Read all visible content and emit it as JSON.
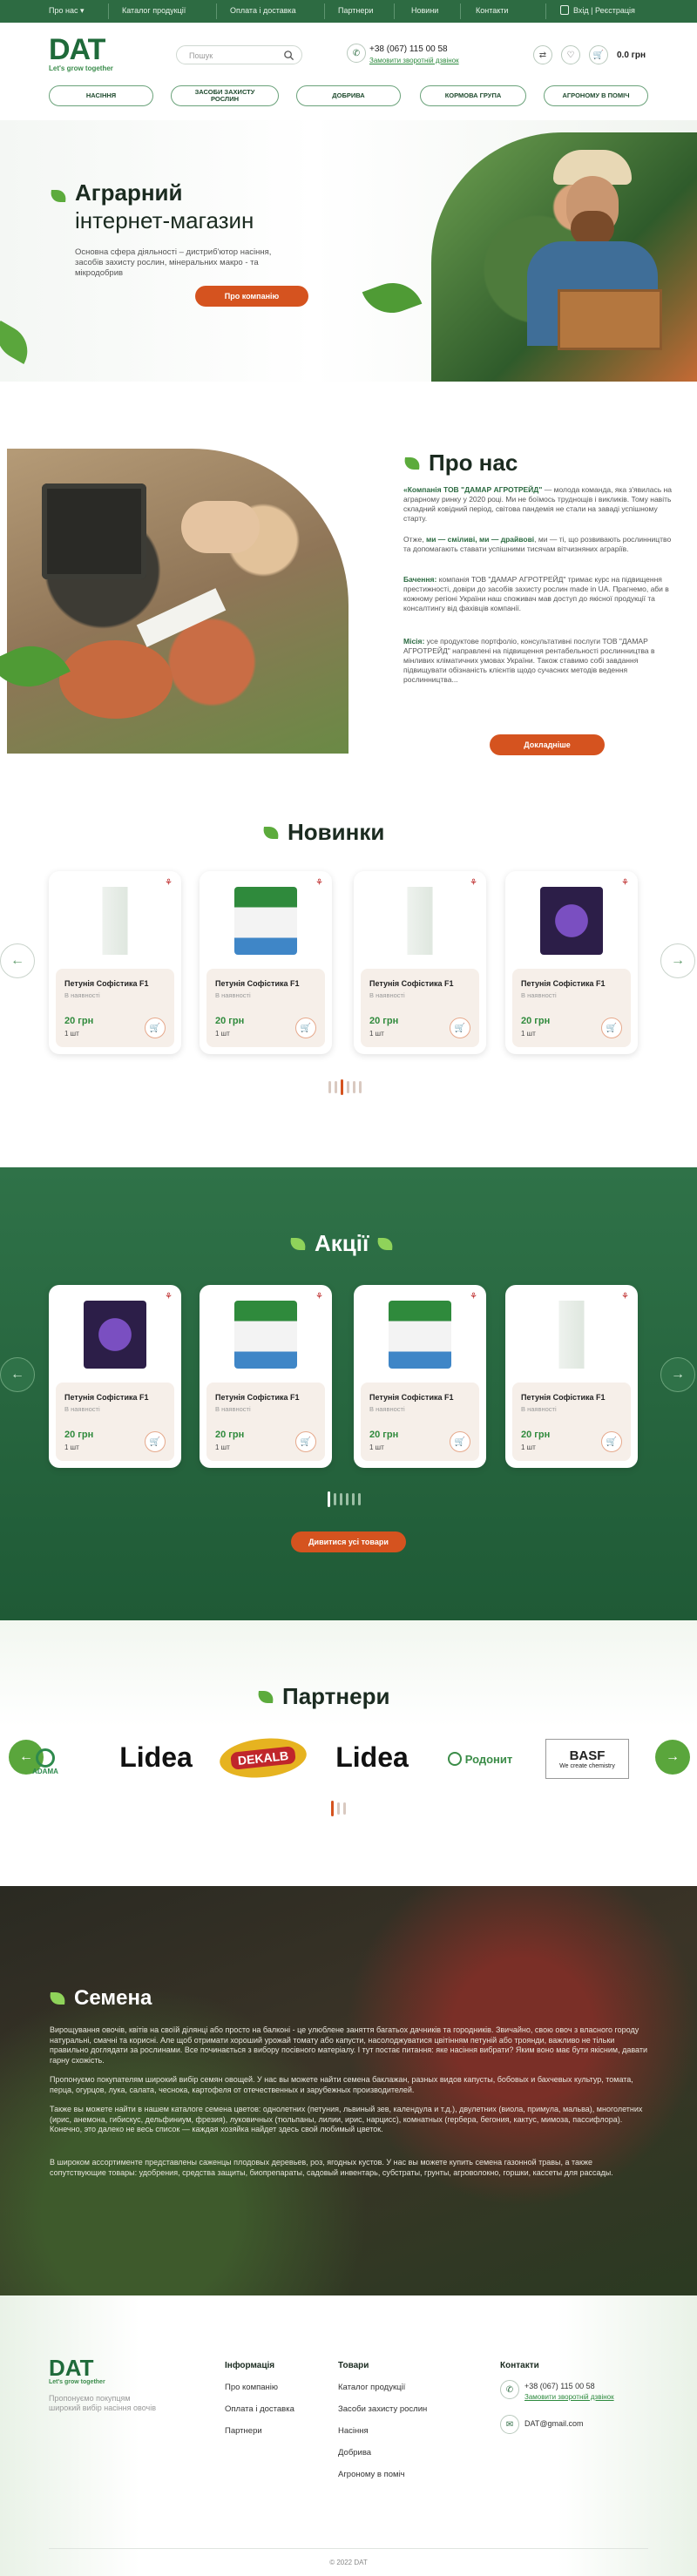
{
  "topbar": {
    "nav": [
      "Про нас",
      "Каталог продукції",
      "Оплата і доставка",
      "Партнери",
      "Новини",
      "Контакти"
    ],
    "login": "Вхід | Реєстрація"
  },
  "header": {
    "logo": "DAT",
    "slogan": "Let's grow together",
    "search_placeholder": "Пошук",
    "phone": "+38 (067) 115 00 58",
    "callback": "Замовити зворотній дзвінок",
    "cart_total": "0.0 грн",
    "categories": [
      "НАСІННЯ",
      "ЗАСОБИ ЗАХИСТУ РОСЛИН",
      "ДОБРИВА",
      "КОРМОВА ГРУПА",
      "АГРОНОМУ В ПОМІЧ"
    ]
  },
  "hero": {
    "title": "Аграрний",
    "subtitle": "інтернет-магазин",
    "text": "Основна сфера діяльності – дистриб'ютор насіння, засобів захисту рослин, мінеральних макро - та мікродобрив",
    "button": "Про компанію"
  },
  "about": {
    "title": "Про нас",
    "p1_bold": "«Компанія ТОВ \"ДАМАР АГРОТРЕЙД\"",
    "p1": " — молода команда, яка з'явилась на аграрному ринку у 2020 році. Ми не боїмось труднощів і викликів. Тому навіть складний ковідний період, світова пандемія не стали на заваді успішному старту.",
    "p2_a": "Отже, ",
    "p2_b1": "ми — сміливі, ми — драйвові",
    "p2_c": ", ми — ті, що розвивають рослинництво та допомагають ставати успішними тисячам вітчизняних аграріїв.",
    "p3_bold": "Бачення:",
    "p3": " компанія ТОВ \"ДАМАР АГРОТРЕЙД\" тримає курс на підвищення престижності, довіри до засобів захисту рослин made in UA. Прагнемо, аби в кожному регіоні України наш споживач мав доступ до якісної продукції та консалтингу від фахівців компанії.",
    "p4_bold": "Місія:",
    "p4": " усе продуктове портфоліо, консультативні послуги ТОВ \"ДАМАР АГРОТРЕЙД\" направлені на підвищення рентабельності рослинництва в мінливих кліматичних умовах України. Також ставимо собі завдання підвищувати обізнаність клієнтів щодо сучасних методів ведення рослинництва...",
    "button": "Докладніше"
  },
  "new_products": {
    "title": "Новинки",
    "items": [
      {
        "name": "Петунія Софістика F1",
        "availability": "В наявності",
        "price": "20 грн",
        "qty": "1 шт",
        "img": "bottle"
      },
      {
        "name": "Петунія Софістика F1",
        "availability": "В наявності",
        "price": "20 грн",
        "qty": "1 шт",
        "img": "box"
      },
      {
        "name": "Петунія Софістика F1",
        "availability": "В наявності",
        "price": "20 грн",
        "qty": "1 шт",
        "img": "bottle"
      },
      {
        "name": "Петунія Софістика F1",
        "availability": "В наявності",
        "price": "20 грн",
        "qty": "1 шт",
        "img": "flower"
      }
    ]
  },
  "promo": {
    "title": "Акції",
    "button": "Дивитися усі товари",
    "items": [
      {
        "name": "Петунія Софістика F1",
        "availability": "В наявності",
        "price": "20 грн",
        "qty": "1 шт",
        "img": "flower"
      },
      {
        "name": "Петунія Софістика F1",
        "availability": "В наявності",
        "price": "20 грн",
        "qty": "1 шт",
        "img": "box"
      },
      {
        "name": "Петунія Софістика F1",
        "availability": "В наявності",
        "price": "20 грн",
        "qty": "1 шт",
        "img": "box"
      },
      {
        "name": "Петунія Софістика F1",
        "availability": "В наявності",
        "price": "20 грн",
        "qty": "1 шт",
        "img": "bottle"
      }
    ]
  },
  "partners": {
    "title": "Партнери",
    "logos": [
      "ADAMA",
      "Lidea",
      "DEKALB",
      "Lidea",
      "Родонит",
      "BASF",
      "We create chemistry"
    ]
  },
  "seeds": {
    "title": "Семена",
    "p1": "Вирощування овочів, квітів на своїй ділянці або просто на балконі - це улюблене заняття багатьох дачників та городників. Звичайно, свою овоч з власного городу натуральні, смачні та корисні. Але щоб отримати хороший урожай томату або капусти, насолоджуватися цвітінням петуній або троянди, важливо не тільки правильно доглядати за рослинами. Все починається з вибору посівного матеріалу. І тут постає питання: яке насіння вибрати? Яким воно має бути якісним, давати гарну схожість.",
    "p2": "Пропонуємо покупателям широкий вибір семян овощей. У нас вы можете найти семена баклажан, разных видов капусты, бобовых и бахчевых культур, томата, перца, огурцов, лука, салата, чеснока, картофеля от отечественных и зарубежных производителей.",
    "p3": "Также вы можете найти в нашем каталоге семена цветов: однолетних (петуния, львиный зев, календула и т.д.), двулетних (виола, примула, мальва), многолетних (ирис, анемона, гибискус, дельфиниум, фрезия), луковичных (тюльпаны, лилии, ирис, нарцисс), комнатных (гербера, бегония, кактус, мимоза, пассифлора). Конечно, это далеко не весь список — каждая хозяйка найдет здесь свой любимый цветок.",
    "p4": "В широком ассортименте представлены саженцы плодовых деревьев, роз, ягодных кустов. У нас вы можете купить семена газонной травы, а также сопутствующие товары: удобрения, средства защиты, биопрепараты, садовый инвентарь, субстраты, грунты, агроволокно, горшки, кассеты для рассады."
  },
  "footer": {
    "logo": "DAT",
    "slogan": "Let's grow together",
    "desc": "Пропонуємо покупцям широкий вибір насіння овочів",
    "info_title": "Інформація",
    "info_links": [
      "Про компанію",
      "Оплата і доставка",
      "Партнери"
    ],
    "goods_title": "Товари",
    "goods_links": [
      "Каталог продукції",
      "Засоби захисту рослин",
      "Насіння",
      "Добрива",
      "Агроному в поміч"
    ],
    "contacts_title": "Контакти",
    "phone": "+38 (067) 115 00 58",
    "callback": "Замовити зворотній дзвінок",
    "email": "DAT@gmail.com",
    "copyright": "© 2022 DAT"
  },
  "colors": {
    "brand_green": "#2d6b42",
    "accent_orange": "#d5531f",
    "leaf_green": "#5cab3c"
  }
}
